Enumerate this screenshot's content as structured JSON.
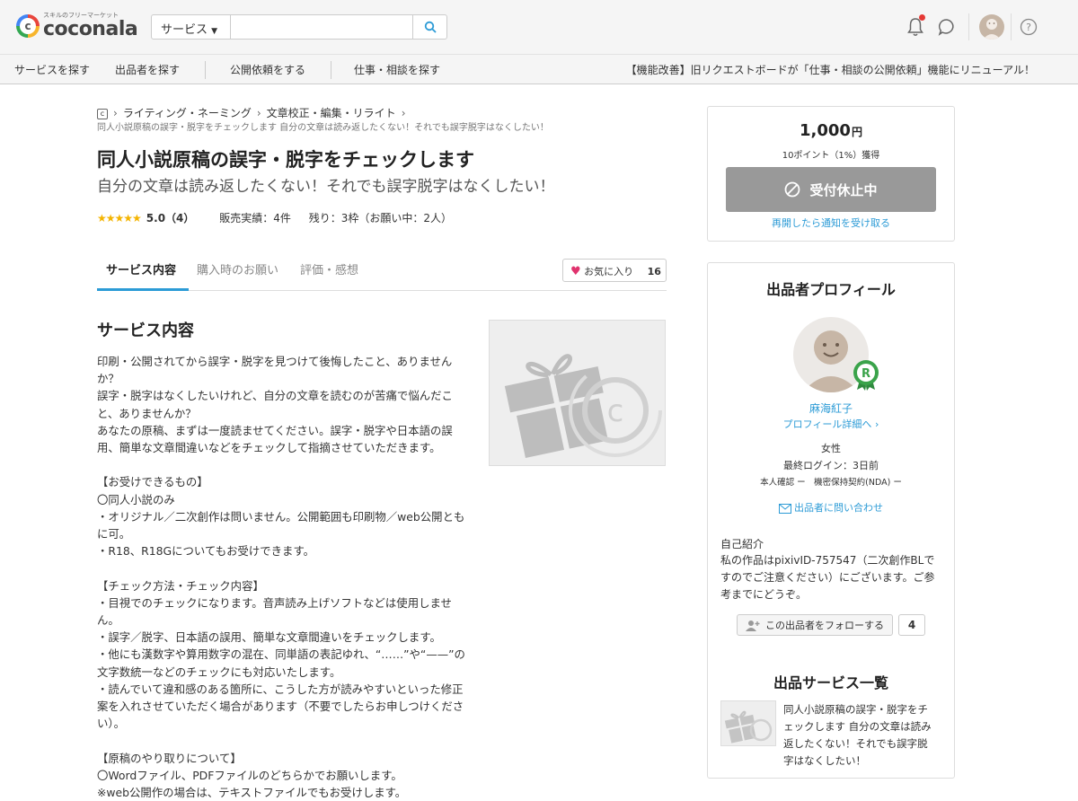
{
  "header": {
    "logo_tagline": "スキルのフリーマーケット",
    "logo_text": "coconala",
    "search_category": "サービス",
    "search_placeholder": "",
    "icons": [
      "bell-icon",
      "chat-icon",
      "avatar",
      "help-icon"
    ]
  },
  "nav": {
    "items": [
      "サービスを探す",
      "出品者を探す",
      "公開依頼をする",
      "仕事・相談を探す"
    ],
    "news": "【機能改善】旧リクエストボードが「仕事・相談の公開依頼」機能にリニューアル！"
  },
  "breadcrumb": {
    "items": [
      "ライティング・ネーミング",
      "文章校正・編集・リライト"
    ],
    "current": "同人小説原稿の誤字・脱字をチェックします 自分の文章は読み返したくない！それでも誤字脱字はなくしたい！"
  },
  "service": {
    "title": "同人小説原稿の誤字・脱字をチェックします",
    "subtitle": "自分の文章は読み返したくない！それでも誤字脱字はなくしたい！",
    "stars": "★★★★★",
    "rating_score": "5.0（4）",
    "sales": "販売実績：4件",
    "remaining": "残り：3枠（お願い中：2人）"
  },
  "tabs": [
    "サービス内容",
    "購入時のお願い",
    "評価・感想"
  ],
  "favorite": {
    "label": "お気に入り",
    "count": "16"
  },
  "content": {
    "heading": "サービス内容",
    "body": "印刷・公開されてから誤字・脱字を見つけて後悔したこと、ありませんか？\n誤字・脱字はなくしたいけれど、自分の文章を読むのが苦痛で悩んだこと、ありませんか？\nあなたの原稿、まずは一度読ませてください。誤字・脱字や日本語の誤用、簡単な文章間違いなどをチェックして指摘させていただきます。\n\n【お受けできるもの】\n〇同人小説のみ\n・オリジナル／二次創作は問いません。公開範囲も印刷物／web公開ともに可。\n・R18、R18Gについてもお受けできます。\n\n【チェック方法・チェック内容】\n・目視でのチェックになります。音声読み上げソフトなどは使用しません。\n・誤字／脱字、日本語の誤用、簡単な文章間違いをチェックします。\n・他にも漢数字や算用数字の混在、同単語の表記ゆれ、“……”や“——”の文字数統一などのチェックにも対応いたします。\n・読んでいて違和感のある箇所に、こうした方が読みやすいといった修正案を入れさせていただく場合があります（不要でしたらお申しつけください）。\n\n【原稿のやり取りについて】\n〇Wordファイル、PDFファイルのどちらかでお願いします。\n※web公開作の場合は、テキストファイルでもお受けします。"
  },
  "purchase": {
    "price": "1,000",
    "price_unit": "円",
    "points": "10ポイント（1%）獲得",
    "status_button": "受付休止中",
    "notify_link": "再開したら通知を受け取る"
  },
  "profile": {
    "heading": "出品者プロフィール",
    "rank_badge": "R",
    "name": "麻海紅子",
    "detail_link": "プロフィール詳細へ",
    "gender": "女性",
    "last_login": "最終ログイン：3日前",
    "verification": "本人確認 ー　機密保持契約(NDA) ー",
    "contact_link": "出品者に問い合わせ",
    "intro_label": "自己紹介",
    "intro_text": "私の作品はpixivID-757547（二次創作BLですのでご注意ください）にございます。ご参考までにどうぞ。",
    "follow_label": "この出品者をフォローする",
    "follow_count": "4"
  },
  "service_list": {
    "heading": "出品サービス一覧",
    "items": [
      {
        "text": "同人小説原稿の誤字・脱字をチェックします 自分の文章は読み返したくない！それでも誤字脱字はなくしたい！"
      }
    ]
  },
  "colors": {
    "accent": "#2c9bd6",
    "star": "#f4b400",
    "heart": "#e0336e",
    "disabled": "#999999"
  }
}
